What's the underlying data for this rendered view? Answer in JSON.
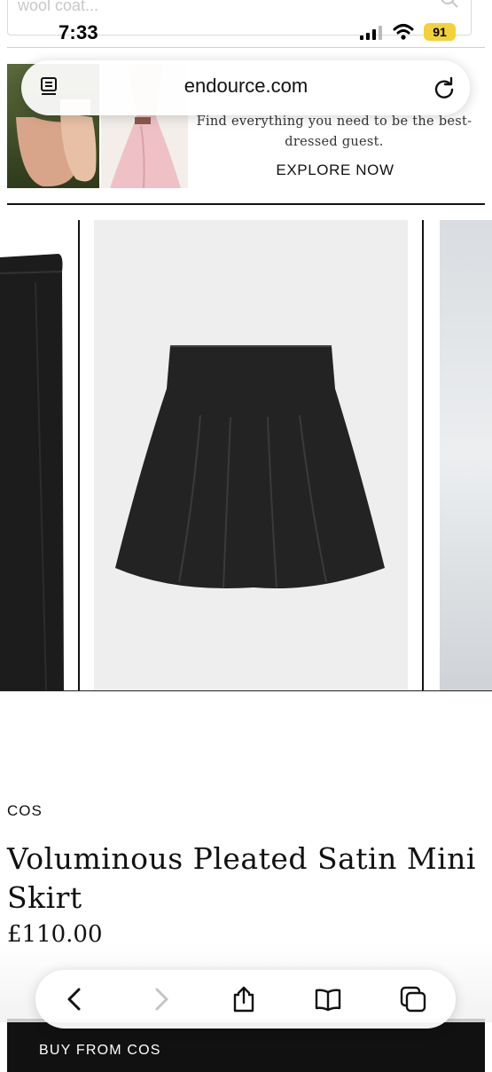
{
  "status_bar": {
    "time": "7:33",
    "battery": "91"
  },
  "search": {
    "placeholder": "wool coat..."
  },
  "banner": {
    "tagline": "Find everything you need to be the best-dressed guest.",
    "cta": "EXPLORE NOW"
  },
  "browser": {
    "url": "endource.com"
  },
  "product": {
    "brand": "COS",
    "title": "Voluminous Pleated Satin Mini Skirt",
    "price": "£110.00",
    "buy_label": "BUY FROM COS"
  },
  "colors": {
    "battery": "#f2d13b",
    "buy_button": "#111111"
  },
  "icons": [
    "search-icon",
    "signal-icon",
    "wifi-icon",
    "reader-icon",
    "reload-icon",
    "back-icon",
    "forward-icon",
    "share-icon",
    "bookmarks-icon",
    "tabs-icon"
  ]
}
